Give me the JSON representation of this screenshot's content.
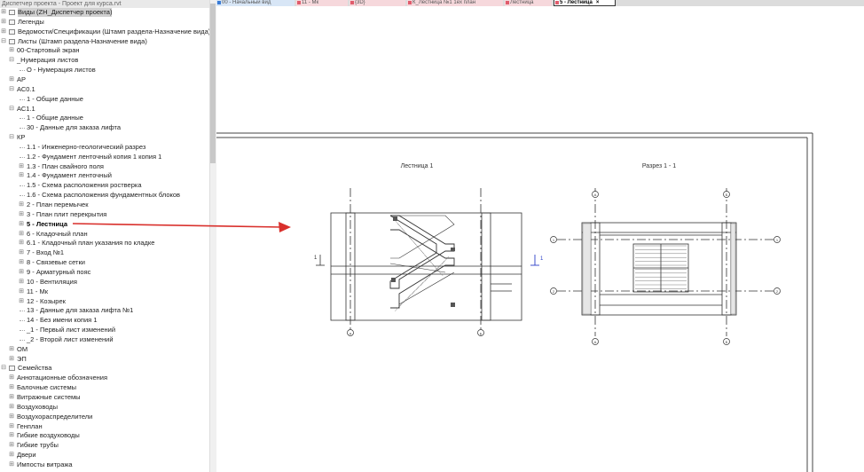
{
  "browser": {
    "title": "Диспетчер проекта - Проект для курса.rvt",
    "items": [
      {
        "label": "Виды (ZH_Диспетчер проекта)",
        "level": 0,
        "exp": "+",
        "icon": true,
        "selected": true
      },
      {
        "label": "Легенды",
        "level": 0,
        "exp": "+",
        "icon": true
      },
      {
        "label": "Ведомости/Спецификации (Штамп раздела-Назначение вида)",
        "level": 0,
        "exp": "+",
        "icon": true
      },
      {
        "label": "Листы (Штамп раздела-Назначение вида)",
        "level": 0,
        "exp": "−",
        "icon": true
      },
      {
        "label": "00-Стартовый экран",
        "level": 1,
        "exp": "+"
      },
      {
        "label": "_Нумерация листов",
        "level": 1,
        "exp": "−"
      },
      {
        "label": "О - Нумерация листов",
        "level": 2,
        "exp": ""
      },
      {
        "label": "АР",
        "level": 1,
        "exp": "+"
      },
      {
        "label": "АС0.1",
        "level": 1,
        "exp": "−"
      },
      {
        "label": "1 - Общие данные",
        "level": 2,
        "exp": ""
      },
      {
        "label": "АС1.1",
        "level": 1,
        "exp": "−"
      },
      {
        "label": "1 - Общие данные",
        "level": 2,
        "exp": ""
      },
      {
        "label": "30 - Данные для заказа лифта",
        "level": 2,
        "exp": ""
      },
      {
        "label": "КР",
        "level": 1,
        "exp": "−"
      },
      {
        "label": "1.1 - Инженерно-геологический разрез",
        "level": 2,
        "exp": ""
      },
      {
        "label": "1.2 - Фундамент ленточный копия 1 копия 1",
        "level": 2,
        "exp": ""
      },
      {
        "label": "1.3 - План свайного поля",
        "level": 2,
        "exp": "+"
      },
      {
        "label": "1.4 - Фундамент ленточный",
        "level": 2,
        "exp": "+"
      },
      {
        "label": "1.5 - Схема расположения ростверка",
        "level": 2,
        "exp": ""
      },
      {
        "label": "1.6 - Схема расположения фундаментных блоков",
        "level": 2,
        "exp": ""
      },
      {
        "label": "2 - План перемычек",
        "level": 2,
        "exp": "+"
      },
      {
        "label": "3 - План плит перекрытия",
        "level": 2,
        "exp": "+"
      },
      {
        "label": "5 - Лестница",
        "level": 2,
        "exp": "+",
        "bold": true
      },
      {
        "label": "6 - Кладочный план",
        "level": 2,
        "exp": "+"
      },
      {
        "label": "6.1 - Кладочный план указания по кладке",
        "level": 2,
        "exp": "+"
      },
      {
        "label": "7 - Вход №1",
        "level": 2,
        "exp": "+"
      },
      {
        "label": "8 - Связевые сетки",
        "level": 2,
        "exp": "+"
      },
      {
        "label": "9 - Арматурный пояс",
        "level": 2,
        "exp": "+"
      },
      {
        "label": "10 - Вентиляция",
        "level": 2,
        "exp": "+"
      },
      {
        "label": "11 - Мк",
        "level": 2,
        "exp": "+"
      },
      {
        "label": "12 - Козырек",
        "level": 2,
        "exp": "+"
      },
      {
        "label": "13 - Данные для заказа лифта №1",
        "level": 2,
        "exp": ""
      },
      {
        "label": "14 - Без имени копия 1",
        "level": 2,
        "exp": ""
      },
      {
        "label": "_1 - Первый лист изменений",
        "level": 2,
        "exp": ""
      },
      {
        "label": "_2 - Второй лист изменений",
        "level": 2,
        "exp": ""
      },
      {
        "label": "ОМ",
        "level": 1,
        "exp": "+"
      },
      {
        "label": "ЭП",
        "level": 1,
        "exp": "+"
      },
      {
        "label": "Семейства",
        "level": 0,
        "exp": "−",
        "icon": true
      },
      {
        "label": "Аннотационные обозначения",
        "level": 1,
        "exp": "+"
      },
      {
        "label": "Балочные системы",
        "level": 1,
        "exp": "+"
      },
      {
        "label": "Витражные системы",
        "level": 1,
        "exp": "+"
      },
      {
        "label": "Воздуховоды",
        "level": 1,
        "exp": "+"
      },
      {
        "label": "Воздухораспределители",
        "level": 1,
        "exp": "+"
      },
      {
        "label": "Генплан",
        "level": 1,
        "exp": "+"
      },
      {
        "label": "Гибкие воздуховоды",
        "level": 1,
        "exp": "+"
      },
      {
        "label": "Гибкие трубы",
        "level": 1,
        "exp": "+"
      },
      {
        "label": "Двери",
        "level": 1,
        "exp": "+"
      },
      {
        "label": "Импосты витража",
        "level": 1,
        "exp": "+"
      }
    ]
  },
  "tabs": [
    {
      "label": "00 - Начальный вид",
      "color": "#3a7bd5",
      "bg": "#d8e6f6"
    },
    {
      "label": "11 - Мк",
      "color": "#e05c6c",
      "bg": "#f6d8dc"
    },
    {
      "label": "{3D}",
      "color": "#e05c6c",
      "bg": "#f6d8dc"
    },
    {
      "label": "К_Лестница №1 1ех план",
      "color": "#e05c6c",
      "bg": "#f6d8dc"
    },
    {
      "label": "Лестница",
      "color": "#e05c6c",
      "bg": "#f6d8dc"
    },
    {
      "label": "5 - Лестница",
      "color": "#e05c6c",
      "bg": "#ffffff",
      "active": true
    }
  ],
  "tab_close": "×",
  "drawing": {
    "plan_title": "Лестница 1",
    "section_title": "Разрез 1 - 1",
    "section_mark": "1",
    "grid_a": "А",
    "grid_b": "Б",
    "grid_1": "1",
    "grid_2": "2"
  },
  "colors": {
    "arrow": "#d9302c",
    "section_mark_blue": "#2b3fc7",
    "sheet_border": "#444444"
  }
}
